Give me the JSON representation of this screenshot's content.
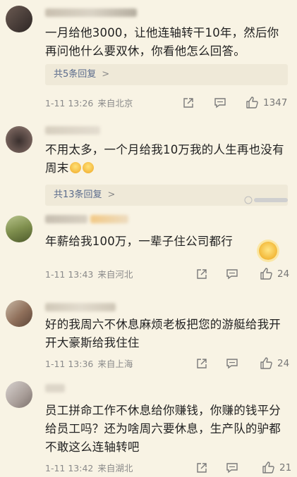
{
  "comments": [
    {
      "text": "一月给他3000，让他连轴转干10年，然后你再问他什么要双休，你看他怎么回答。",
      "reply_label": "共5条回复",
      "time": "1-11 13:26",
      "location": "来自北京",
      "likes": "1347"
    },
    {
      "text": "不用太多，一个月给我10万我的人生再也没有周末",
      "reply_label": "共13条回复"
    },
    {
      "text": "年薪给我100万，一辈子住公司都行",
      "time": "1-11 13:43",
      "location": "来自河北",
      "likes": "24"
    },
    {
      "text": "好的我周六不休息麻烦老板把您的游艇给我开开大豪斯给我住住",
      "time": "1-11 13:36",
      "location": "来自上海",
      "likes": "24"
    },
    {
      "text": "员工拼命工作不休息给你赚钱，你赚的钱平分给员工吗？还为啥周六要休息，生产队的驴都不敢这么连轴转吧",
      "time": "1-11 13:42",
      "location": "来自湖北",
      "likes": "21"
    }
  ],
  "reply_chevron": ">",
  "colors": {
    "background": "#f8f3e4",
    "reply_box": "#efe9d8",
    "reply_text": "#5a6b8c",
    "meta_text": "#8a8a8a"
  }
}
